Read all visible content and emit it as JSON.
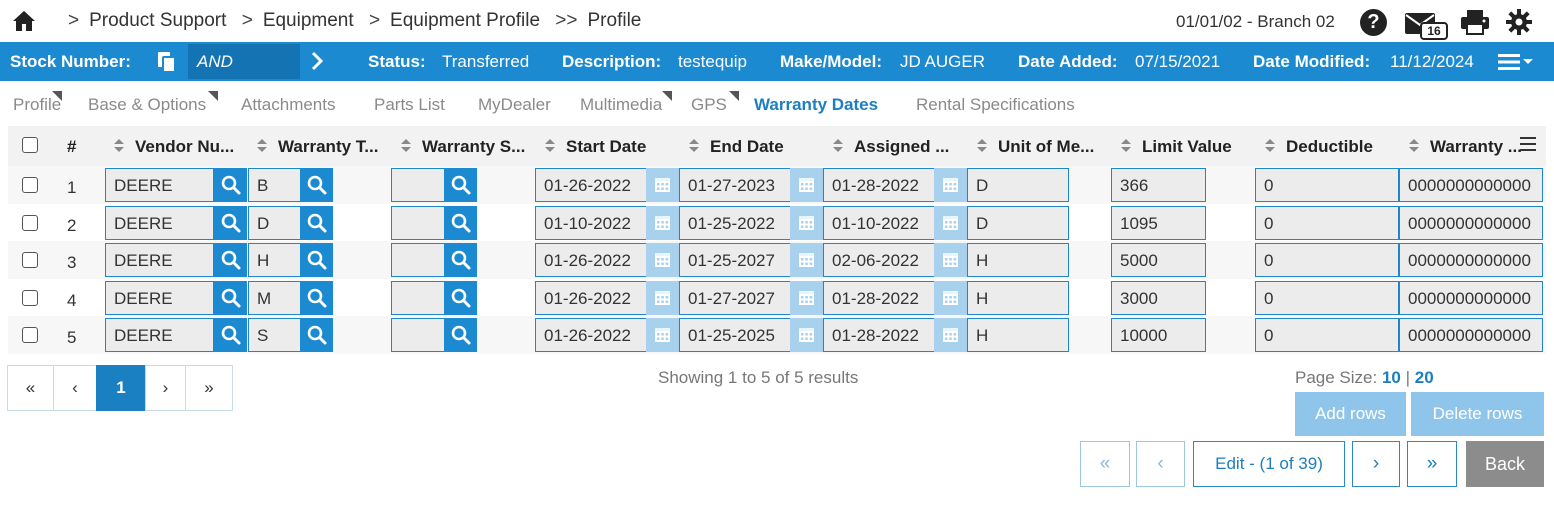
{
  "breadcrumb": {
    "items": [
      "Product Support",
      "Equipment",
      "Equipment Profile",
      "Profile"
    ],
    "separators": [
      ">",
      ">",
      ">",
      ">>"
    ]
  },
  "header": {
    "branch": "01/01/02 - Branch 02",
    "mail_count": "16",
    "help_glyph": "?"
  },
  "infobar": {
    "stock_label": "Stock Number:",
    "stock_value": "AND",
    "status_label": "Status:",
    "status_value": "Transferred",
    "description_label": "Description:",
    "description_value": "testequip",
    "make_label": "Make/Model:",
    "make_value": "JD AUGER",
    "added_label": "Date Added:",
    "added_value": "07/15/2021",
    "modified_label": "Date Modified:",
    "modified_value": "11/12/2024"
  },
  "tabs": [
    {
      "label": "Profile"
    },
    {
      "label": "Base & Options"
    },
    {
      "label": "Attachments"
    },
    {
      "label": "Parts List"
    },
    {
      "label": "MyDealer"
    },
    {
      "label": "Multimedia"
    },
    {
      "label": "GPS"
    },
    {
      "label": "Warranty Dates"
    },
    {
      "label": "Rental Specifications"
    }
  ],
  "active_tab": "Warranty Dates",
  "grid": {
    "columns": [
      "#",
      "Vendor Nu...",
      "Warranty T...",
      "Warranty S...",
      "Start Date",
      "End Date",
      "Assigned ...",
      "Unit of Me...",
      "Limit Value",
      "Deductible",
      "Warranty ..."
    ],
    "rows": [
      {
        "num": "1",
        "vendor": "DEERE",
        "wtype": "B",
        "wsub": "",
        "start": "01-26-2022",
        "end": "01-27-2023",
        "assigned": "01-28-2022",
        "uom": "D",
        "limit": "366",
        "deductible": "0",
        "warranty": "0000000000000"
      },
      {
        "num": "2",
        "vendor": "DEERE",
        "wtype": "D",
        "wsub": "",
        "start": "01-10-2022",
        "end": "01-25-2022",
        "assigned": "01-10-2022",
        "uom": "D",
        "limit": "1095",
        "deductible": "0",
        "warranty": "0000000000000"
      },
      {
        "num": "3",
        "vendor": "DEERE",
        "wtype": "H",
        "wsub": "",
        "start": "01-26-2022",
        "end": "01-25-2027",
        "assigned": "02-06-2022",
        "uom": "H",
        "limit": "5000",
        "deductible": "0",
        "warranty": "0000000000000"
      },
      {
        "num": "4",
        "vendor": "DEERE",
        "wtype": "M",
        "wsub": "",
        "start": "01-26-2022",
        "end": "01-27-2027",
        "assigned": "01-28-2022",
        "uom": "H",
        "limit": "3000",
        "deductible": "0",
        "warranty": "0000000000000"
      },
      {
        "num": "5",
        "vendor": "DEERE",
        "wtype": "S",
        "wsub": "",
        "start": "01-26-2022",
        "end": "01-25-2025",
        "assigned": "01-28-2022",
        "uom": "H",
        "limit": "10000",
        "deductible": "0",
        "warranty": "0000000000000"
      }
    ]
  },
  "pager": {
    "first": "«",
    "prev": "‹",
    "current": "1",
    "next": "›",
    "last": "»",
    "summary": "Showing 1 to 5 of 5 results",
    "page_size_label": "Page Size:",
    "page_size_selected": "10",
    "page_size_sep": "|",
    "page_size_other": "20"
  },
  "actions": {
    "add_rows": "Add rows",
    "delete_rows": "Delete rows"
  },
  "record_nav": {
    "first": "«",
    "prev": "‹",
    "edit": "Edit - (1 of 39)",
    "next": "›",
    "last": "»",
    "back": "Back"
  },
  "colors": {
    "brand_blue": "#1b8ad0",
    "active_tab": "#1b7fc1",
    "disabled_action": "#8fc5ea",
    "back_button": "#8c8c8c"
  }
}
